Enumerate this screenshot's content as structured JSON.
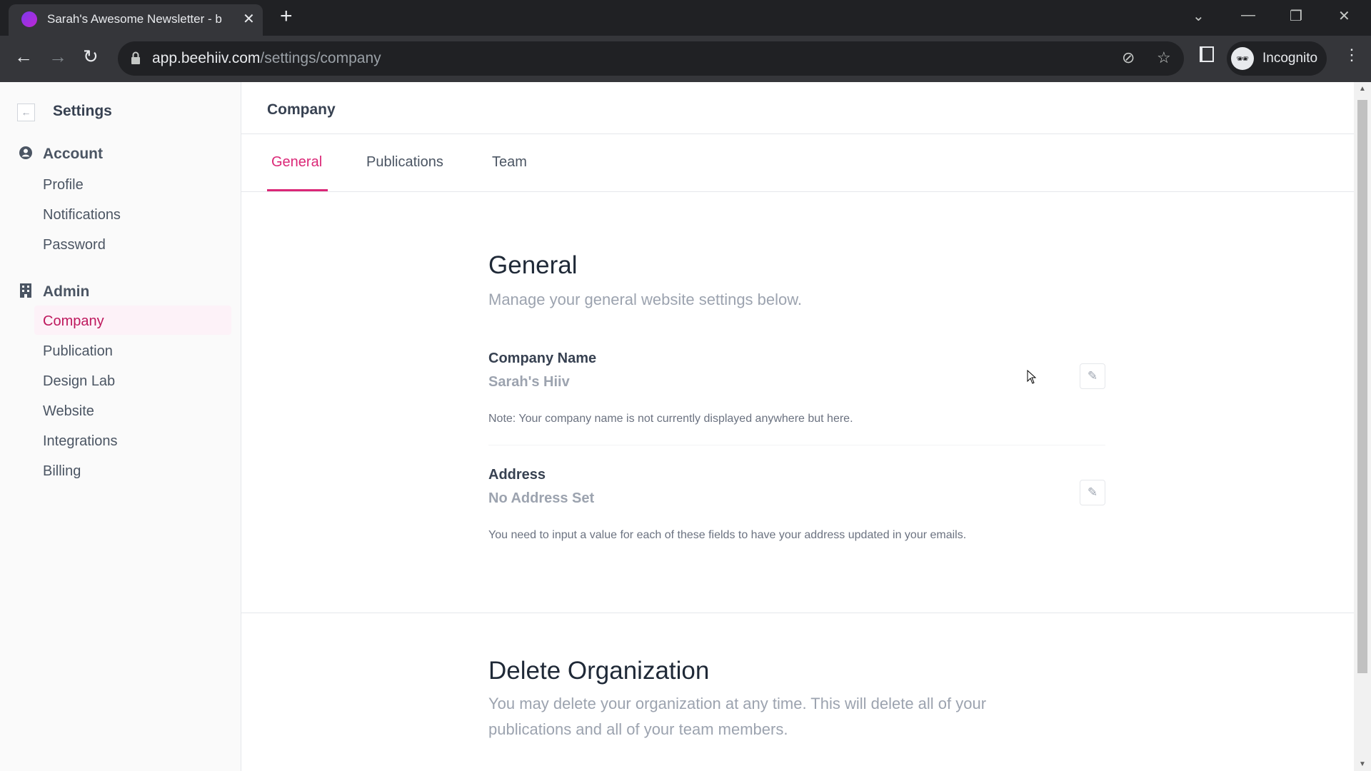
{
  "browser": {
    "tab_title": "Sarah's Awesome Newsletter - b",
    "url_domain": "app.beehiiv.com",
    "url_path": "/settings/company",
    "profile_label": "Incognito"
  },
  "sidebar": {
    "title": "Settings",
    "sections": [
      {
        "label": "Account",
        "icon": "user-circle-icon",
        "items": [
          "Profile",
          "Notifications",
          "Password"
        ]
      },
      {
        "label": "Admin",
        "icon": "building-icon",
        "items": [
          "Company",
          "Publication",
          "Design Lab",
          "Website",
          "Integrations",
          "Billing"
        ]
      }
    ],
    "active_item": "Company"
  },
  "main": {
    "header": "Company",
    "tabs": [
      {
        "label": "General",
        "active": true
      },
      {
        "label": "Publications"
      },
      {
        "label": "Team"
      }
    ],
    "general": {
      "title": "General",
      "subtitle": "Manage your general website settings below.",
      "fields": [
        {
          "label": "Company Name",
          "value": "Sarah's Hiiv",
          "note": "Note: Your company name is not currently displayed anywhere but here."
        },
        {
          "label": "Address",
          "value": "No Address Set",
          "note": "You need to input a value for each of these fields to have your address updated in your emails."
        }
      ]
    },
    "delete": {
      "title": "Delete Organization",
      "text_line1": "You may delete your organization at any time. This will delete all of your",
      "text_line2": "publications and all of your team members."
    }
  },
  "colors": {
    "accent": "#db2777",
    "active_bg": "#fdf2f8"
  }
}
